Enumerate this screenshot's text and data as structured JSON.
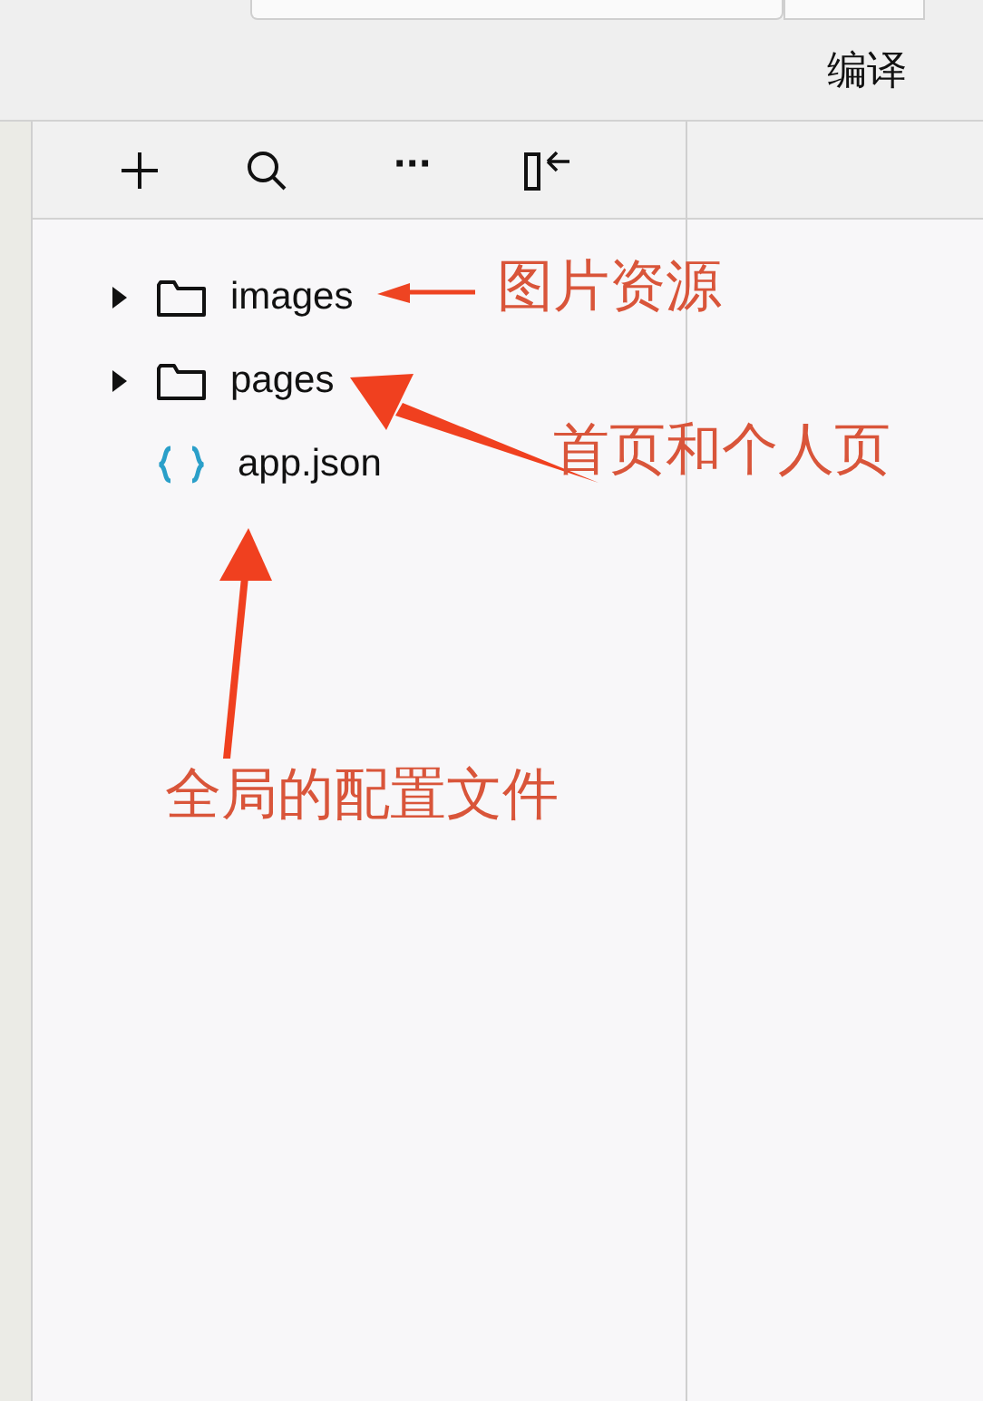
{
  "header": {
    "compile_button": "编译"
  },
  "toolbar": {
    "more": "···"
  },
  "tree": [
    {
      "kind": "folder",
      "label": "images",
      "expanded": false
    },
    {
      "kind": "folder",
      "label": "pages",
      "expanded": false
    },
    {
      "kind": "json",
      "label": "app.json"
    }
  ],
  "annotations": [
    "图片资源",
    "首页和个人页",
    "全局的配置文件"
  ]
}
